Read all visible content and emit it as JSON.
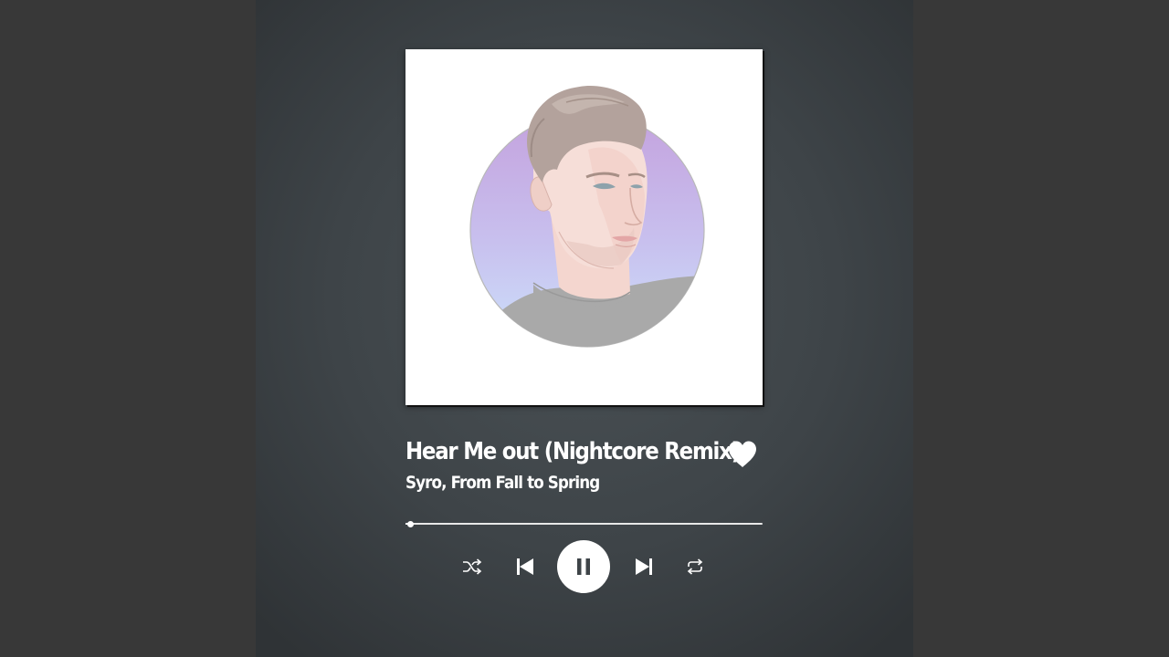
{
  "track": {
    "title": "Hear Me out (Nightcore Remix)",
    "artist": "Syro, From Fall to Spring",
    "liked": true
  },
  "playback": {
    "progress": 0.007,
    "state": "playing"
  },
  "icons": {
    "like": "heart-icon",
    "shuffle": "shuffle-icon",
    "previous": "skip-previous-icon",
    "pause": "pause-icon",
    "next": "skip-next-icon",
    "repeat": "repeat-icon"
  },
  "colors": {
    "background": "#383838",
    "card": "#3e4448",
    "text": "#ffffff",
    "avatar_gradient_top": "#c7a6e0",
    "avatar_gradient_bottom": "#c9dcf7"
  }
}
